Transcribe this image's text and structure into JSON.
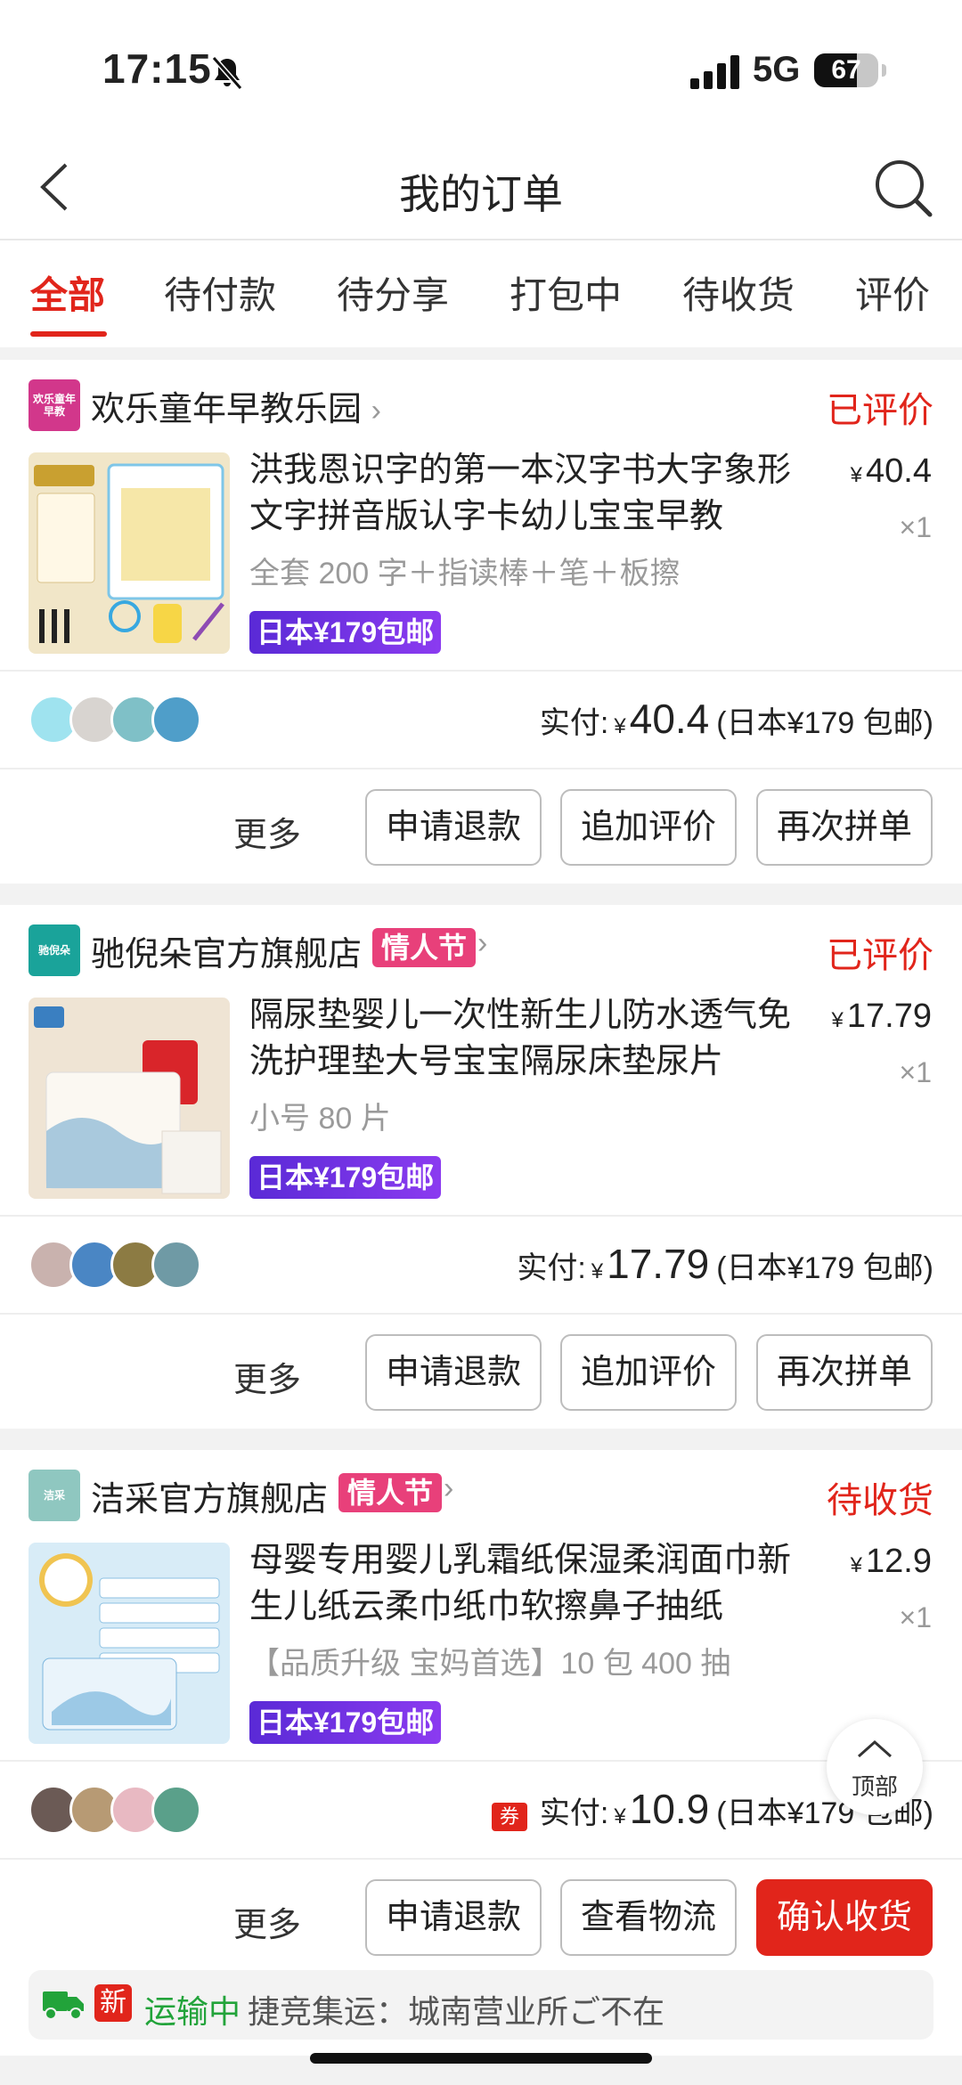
{
  "status_bar": {
    "time": "17:15",
    "network": "5G",
    "battery": "67",
    "battery_level": 0.67
  },
  "header": {
    "title": "我的订单"
  },
  "tabs": [
    {
      "label": "全部",
      "active": true
    },
    {
      "label": "待付款"
    },
    {
      "label": "待分享"
    },
    {
      "label": "打包中"
    },
    {
      "label": "待收货"
    },
    {
      "label": "评价"
    }
  ],
  "orders": [
    {
      "shop_logo_text": "欢乐童年早教",
      "shop_name": "欢乐童年早教乐园",
      "status": "已评价",
      "title": "洪我恩识字的第一本汉字书大字象形文字拼音版认字卡幼儿宝宝早教",
      "price": "40.4",
      "qty": "×1",
      "spec": "全套 200 字＋指读棒＋笔＋板擦",
      "ship_tag": "日本¥179包邮",
      "paid_label": "实付:",
      "paid_amount": "40.4",
      "paid_note": "(日本¥179 包邮)",
      "more": "更多",
      "buttons": [
        "申请退款",
        "追加评价",
        "再次拼单"
      ]
    },
    {
      "shop_logo_text": "驰倪朵",
      "shop_name": "驰倪朵官方旗舰店",
      "promo": "情人节",
      "status": "已评价",
      "title": "隔尿垫婴儿一次性新生儿防水透气免洗护理垫大号宝宝隔尿床垫尿片",
      "price": "17.79",
      "qty": "×1",
      "spec": "小号 80 片",
      "ship_tag": "日本¥179包邮",
      "paid_label": "实付:",
      "paid_amount": "17.79",
      "paid_note": "(日本¥179 包邮)",
      "more": "更多",
      "buttons": [
        "申请退款",
        "追加评价",
        "再次拼单"
      ]
    },
    {
      "shop_logo_text": "洁采",
      "shop_name": "洁采官方旗舰店",
      "promo": "情人节",
      "status": "待收货",
      "title": "母婴专用婴儿乳霜纸保湿柔润面巾新生儿纸云柔巾纸巾软擦鼻子抽纸",
      "price": "12.9",
      "qty": "×1",
      "spec": "【品质升级 宝妈首选】10 包 400 抽",
      "ship_tag": "日本¥179包邮",
      "coupon": "券",
      "paid_label": "实付:",
      "paid_amount": "10.9",
      "paid_note": "(日本¥179 包邮)",
      "more": "更多",
      "buttons": [
        "申请退款",
        "查看物流",
        "确认收货"
      ],
      "logistics": {
        "badge": "新",
        "status": "运输中",
        "text": "捷竞集运：城南营业所ご不在"
      }
    }
  ],
  "to_top": "顶部",
  "colors": {
    "accent": "#e1251b",
    "ship_tag": "#7b35ea",
    "promo": "#e8407a",
    "logistics_green": "#22a33a"
  }
}
